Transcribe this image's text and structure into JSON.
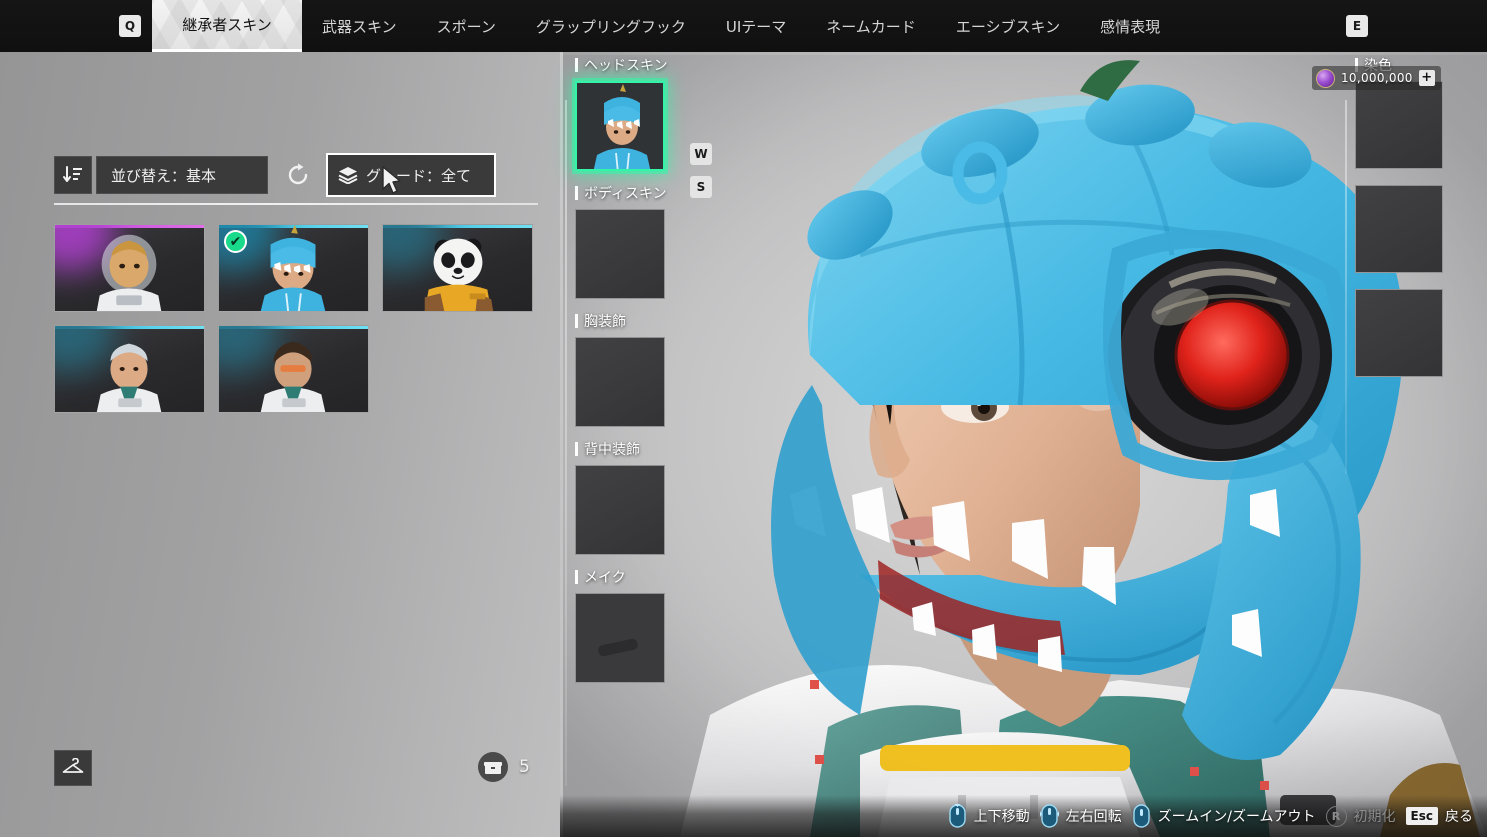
{
  "topnav": {
    "left_key": "Q",
    "right_key": "E",
    "tabs": [
      {
        "label": "継承者スキン",
        "active": true
      },
      {
        "label": "武器スキン",
        "active": false
      },
      {
        "label": "スポーン",
        "active": false
      },
      {
        "label": "グラップリングフック",
        "active": false
      },
      {
        "label": "UIテーマ",
        "active": false
      },
      {
        "label": "ネームカード",
        "active": false
      },
      {
        "label": "エーシブスキン",
        "active": false
      },
      {
        "label": "感情表現",
        "active": false
      }
    ]
  },
  "toolbar": {
    "sort_icon": "sort-descending-icon",
    "sort_label": "並び替え：基本",
    "reset_icon": "refresh-icon",
    "grade_icon": "layers-icon",
    "grade_label": "グレード：全て"
  },
  "thumbnails": [
    {
      "name": "astronaut-helmet-skin",
      "rarity_color": "#d45ad8",
      "glow_color": "#c03fd6",
      "selected": false,
      "type": "astronaut"
    },
    {
      "name": "blue-dino-hood-skin",
      "rarity_color": "#3ec6e0",
      "glow_color": "#1f8fae",
      "selected": true,
      "type": "dino"
    },
    {
      "name": "panda-mascot-skin",
      "rarity_color": "#3ec6e0",
      "glow_color": "#2b6e86",
      "selected": false,
      "type": "panda"
    },
    {
      "name": "white-hair-default-skin",
      "rarity_color": "#3ec6e0",
      "glow_color": "#2b6e86",
      "selected": false,
      "type": "whitehair"
    },
    {
      "name": "dark-hair-visor-skin",
      "rarity_color": "#3ec6e0",
      "glow_color": "#2b6e86",
      "selected": false,
      "type": "darkhair"
    }
  ],
  "selection_check": "✔",
  "bottom_left": {
    "hanger_icon": "clothes-hanger-icon",
    "inventory_icon": "storage-box-icon",
    "inventory_count": "5"
  },
  "slots": [
    {
      "label": "ヘッドスキン",
      "name": "head-skin-slot",
      "selected": true,
      "empty": false
    },
    {
      "label": "ボディスキン",
      "name": "body-skin-slot",
      "selected": false,
      "empty": true
    },
    {
      "label": "胸装飾",
      "name": "chest-decoration-slot",
      "selected": false,
      "empty": true
    },
    {
      "label": "背中装飾",
      "name": "back-decoration-slot",
      "selected": false,
      "empty": true
    },
    {
      "label": "メイク",
      "name": "makeup-slot",
      "selected": false,
      "empty": true
    }
  ],
  "key_hints": {
    "up": "W",
    "down": "S"
  },
  "dye": {
    "label": "染色",
    "swatches": [
      "dye-slot-1",
      "dye-slot-2",
      "dye-slot-3"
    ]
  },
  "currency": {
    "icon": "premium-gem-icon",
    "amount": "10,000,000",
    "add_label": "+"
  },
  "hints": [
    {
      "icon": "mouse-vertical-icon",
      "label": "上下移動",
      "disabled": false
    },
    {
      "icon": "mouse-horizontal-icon",
      "label": "左右回転",
      "disabled": false
    },
    {
      "icon": "mouse-scroll-icon",
      "label": "ズームイン/ズームアウト",
      "disabled": false
    },
    {
      "icon": "key-r-icon",
      "label": "初期化",
      "disabled": true,
      "key": "R"
    },
    {
      "icon": "key-esc-icon",
      "label": "戻る",
      "disabled": false,
      "key": "Esc"
    }
  ],
  "colors": {
    "accent_green": "#34f5a7",
    "panel_dark": "#3a3a3a",
    "nav_bg": "#111111"
  }
}
